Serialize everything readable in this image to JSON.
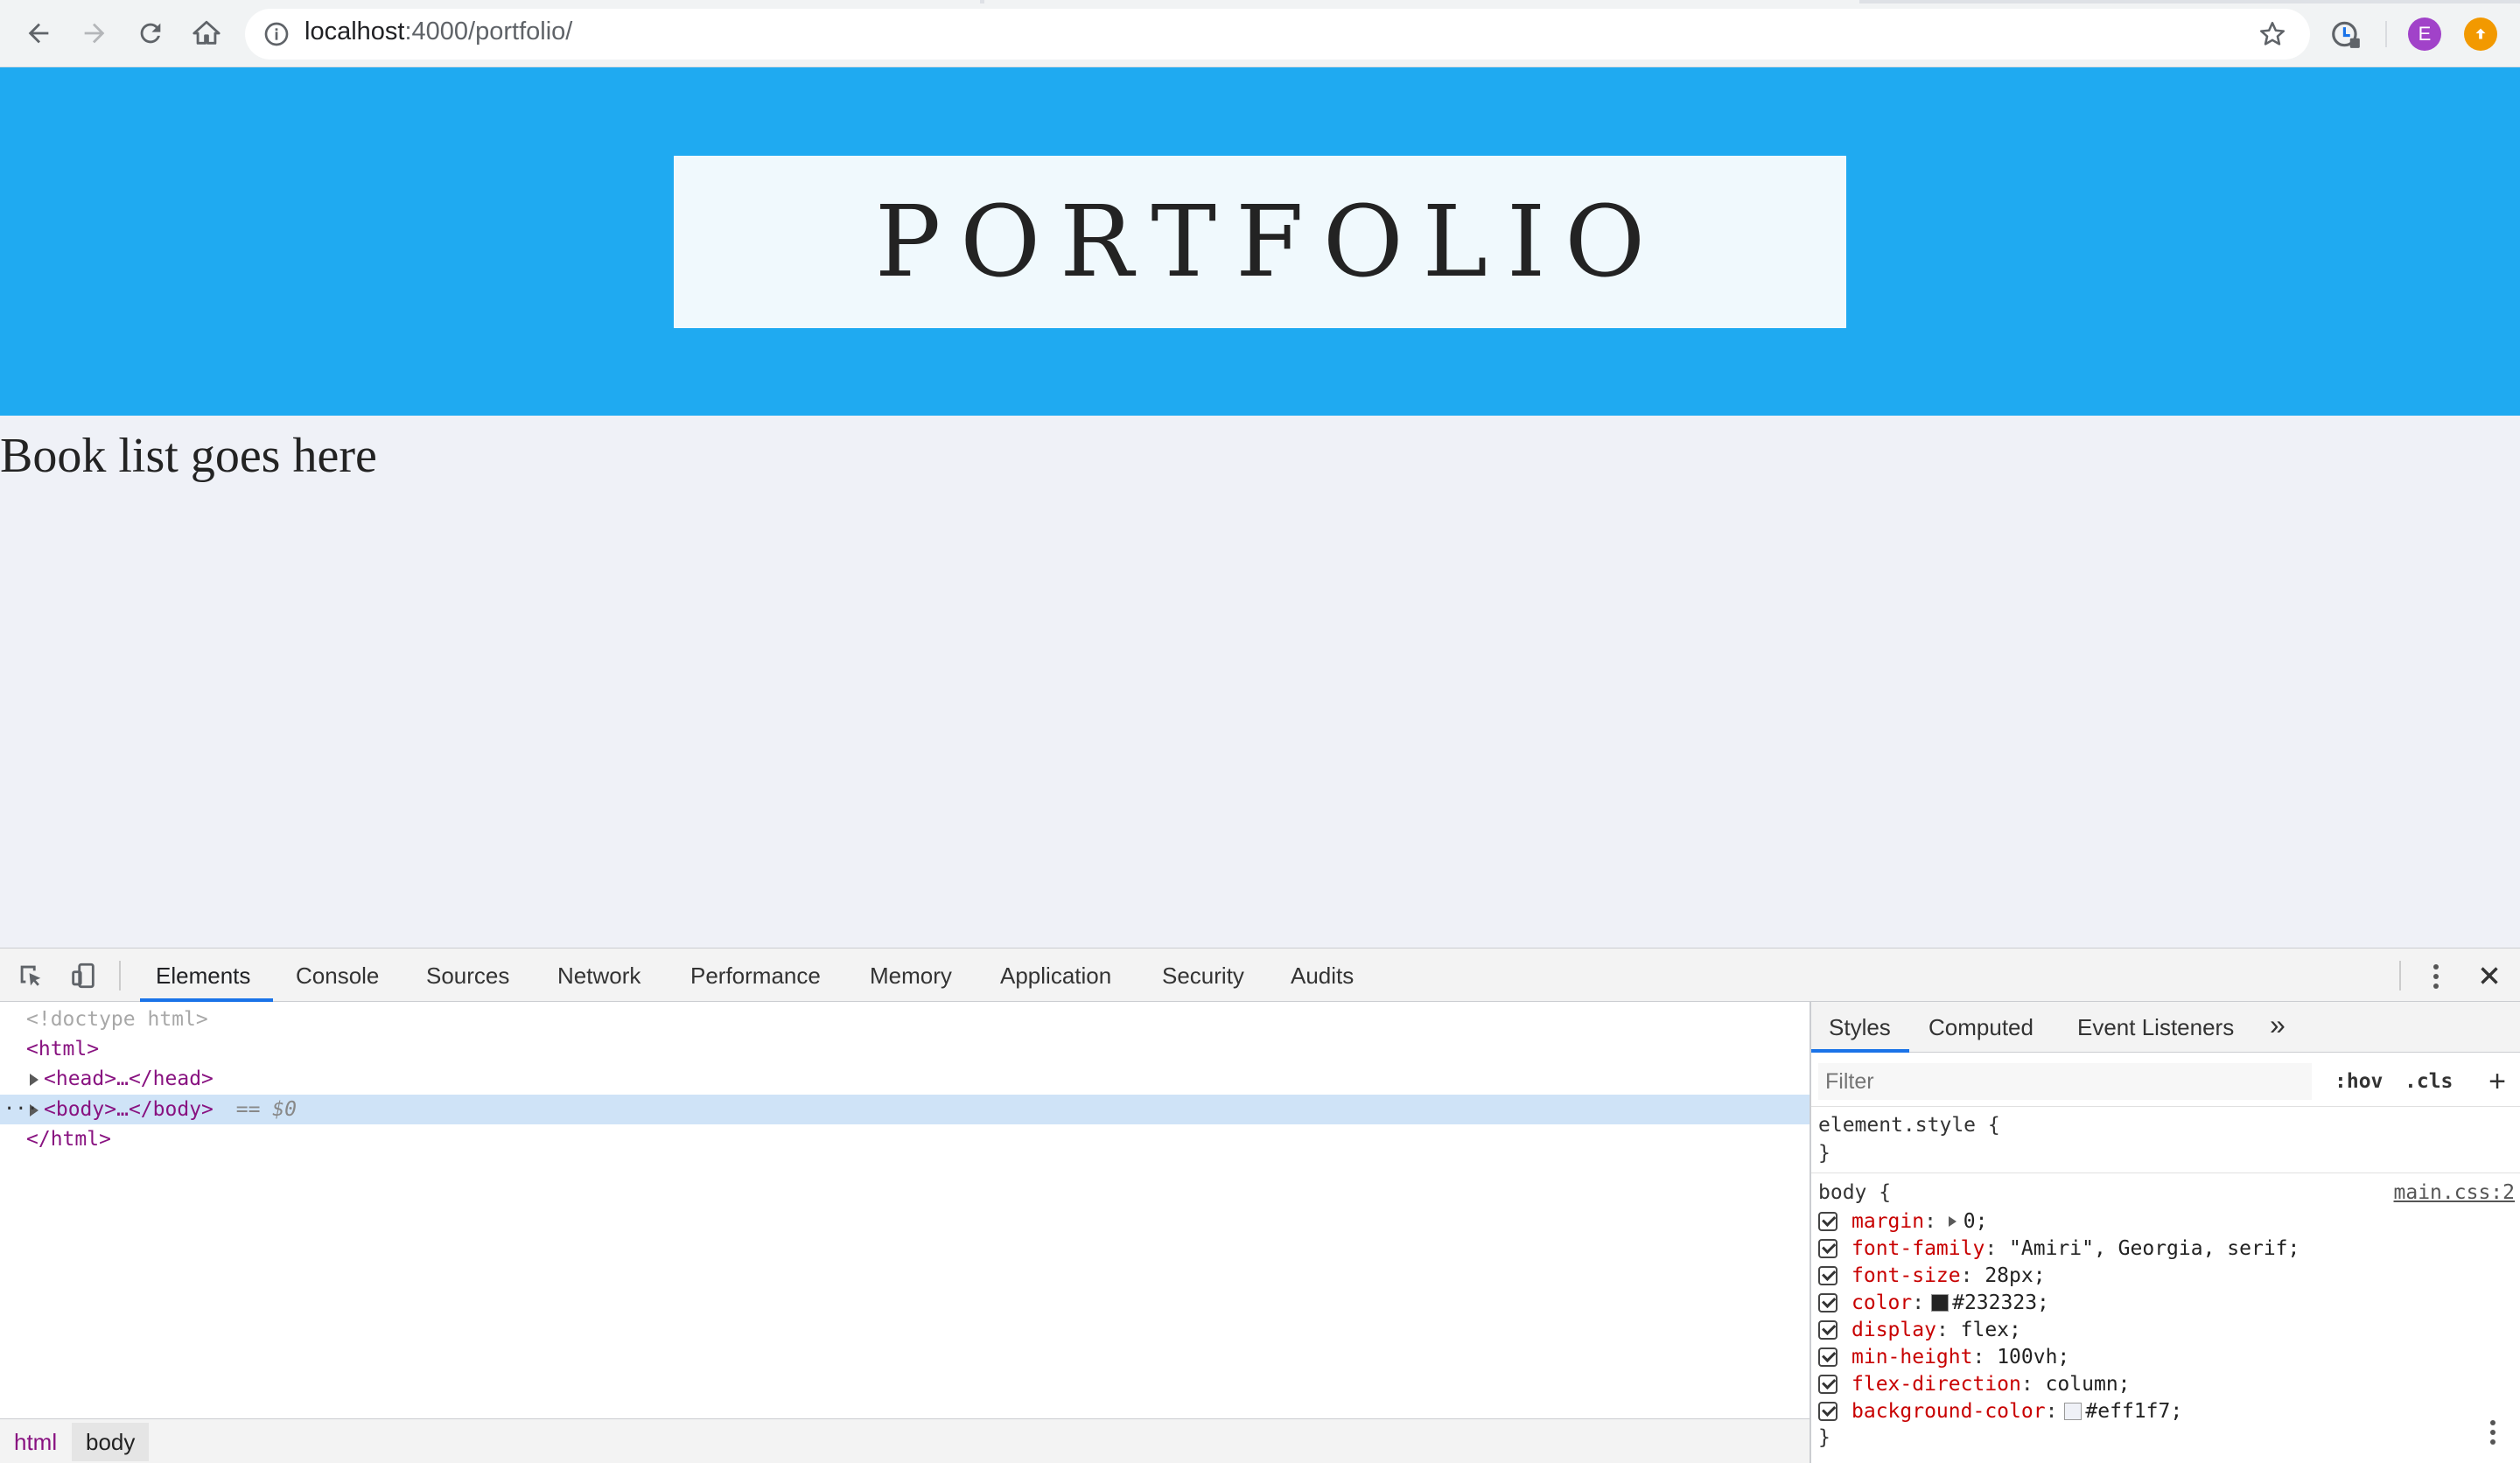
{
  "browser": {
    "url_host": "localhost",
    "url_path": ":4000/portfolio/",
    "profile_initial": "E",
    "profile_color": "#a142c9",
    "update_color": "#f29900"
  },
  "page": {
    "header_bg": "#1faaf1",
    "title": "PORTFOLIO",
    "body_text": "Book list goes here"
  },
  "devtools": {
    "tabs": [
      "Elements",
      "Console",
      "Sources",
      "Network",
      "Performance",
      "Memory",
      "Application",
      "Security",
      "Audits"
    ],
    "active_tab": "Elements",
    "dom": {
      "doctype": "<!doctype html>",
      "html_open": "<html>",
      "head_open": "<head>",
      "head_ellipsis": "…",
      "head_close": "</head>",
      "body_open": "<body>",
      "body_ellipsis": "…",
      "body_close": "</body>",
      "selected_marker": "== $0",
      "html_close": "</html>",
      "row_dots": "···"
    },
    "breadcrumbs": [
      "html",
      "body"
    ],
    "styles": {
      "tabs": [
        "Styles",
        "Computed",
        "Event Listeners"
      ],
      "more": "»",
      "filter_placeholder": "Filter",
      "hov": ":hov",
      "cls": ".cls",
      "add": "+",
      "element_style": "element.style {",
      "close_brace": "}",
      "rule_selector": "body {",
      "rule_source": "main.css:2",
      "properties": [
        {
          "name": "margin",
          "value": "0;",
          "expand": true
        },
        {
          "name": "font-family",
          "value": "\"Amiri\", Georgia, serif;"
        },
        {
          "name": "font-size",
          "value": "28px;"
        },
        {
          "name": "color",
          "value": "#232323;",
          "swatch": "#232323"
        },
        {
          "name": "display",
          "value": "flex;"
        },
        {
          "name": "min-height",
          "value": "100vh;"
        },
        {
          "name": "flex-direction",
          "value": "column;"
        },
        {
          "name": "background-color",
          "value": "#eff1f7;",
          "swatch": "#eff1f7"
        }
      ]
    }
  }
}
